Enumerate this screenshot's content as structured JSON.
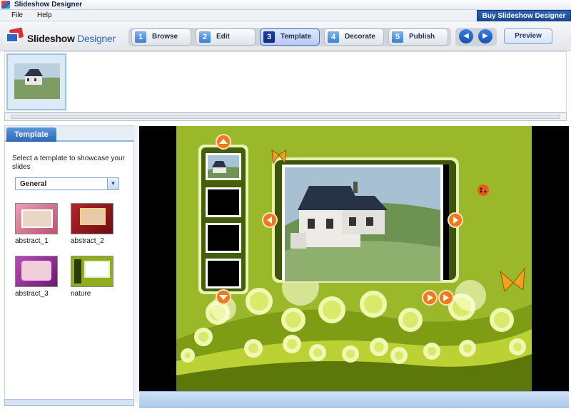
{
  "window": {
    "title": "Slideshow Designer"
  },
  "menu": {
    "file": "File",
    "help": "Help"
  },
  "buy_button": "Buy Slideshow Designer",
  "logo": {
    "part1": "Slideshow",
    "part2": "Designer"
  },
  "steps": [
    {
      "num": "1",
      "label": "Browse",
      "active": false
    },
    {
      "num": "2",
      "label": "Edit",
      "active": false
    },
    {
      "num": "3",
      "label": "Template",
      "active": true
    },
    {
      "num": "4",
      "label": "Decorate",
      "active": false
    },
    {
      "num": "5",
      "label": "Publish",
      "active": false
    }
  ],
  "nav": {
    "prev_icon": "chevron-left-icon",
    "next_icon": "chevron-right-icon"
  },
  "preview_label": "Preview",
  "panel": {
    "tab": "Template",
    "description": "Select a template to showcase your slides",
    "category": "General",
    "templates": [
      {
        "name": "abstract_1"
      },
      {
        "name": "abstract_2"
      },
      {
        "name": "abstract_3"
      },
      {
        "name": "nature"
      }
    ]
  },
  "colors": {
    "accent": "#2f68b6",
    "stage_green": "#9bb82a",
    "stage_dark": "#3d5a06",
    "orange": "#f07a1a"
  }
}
